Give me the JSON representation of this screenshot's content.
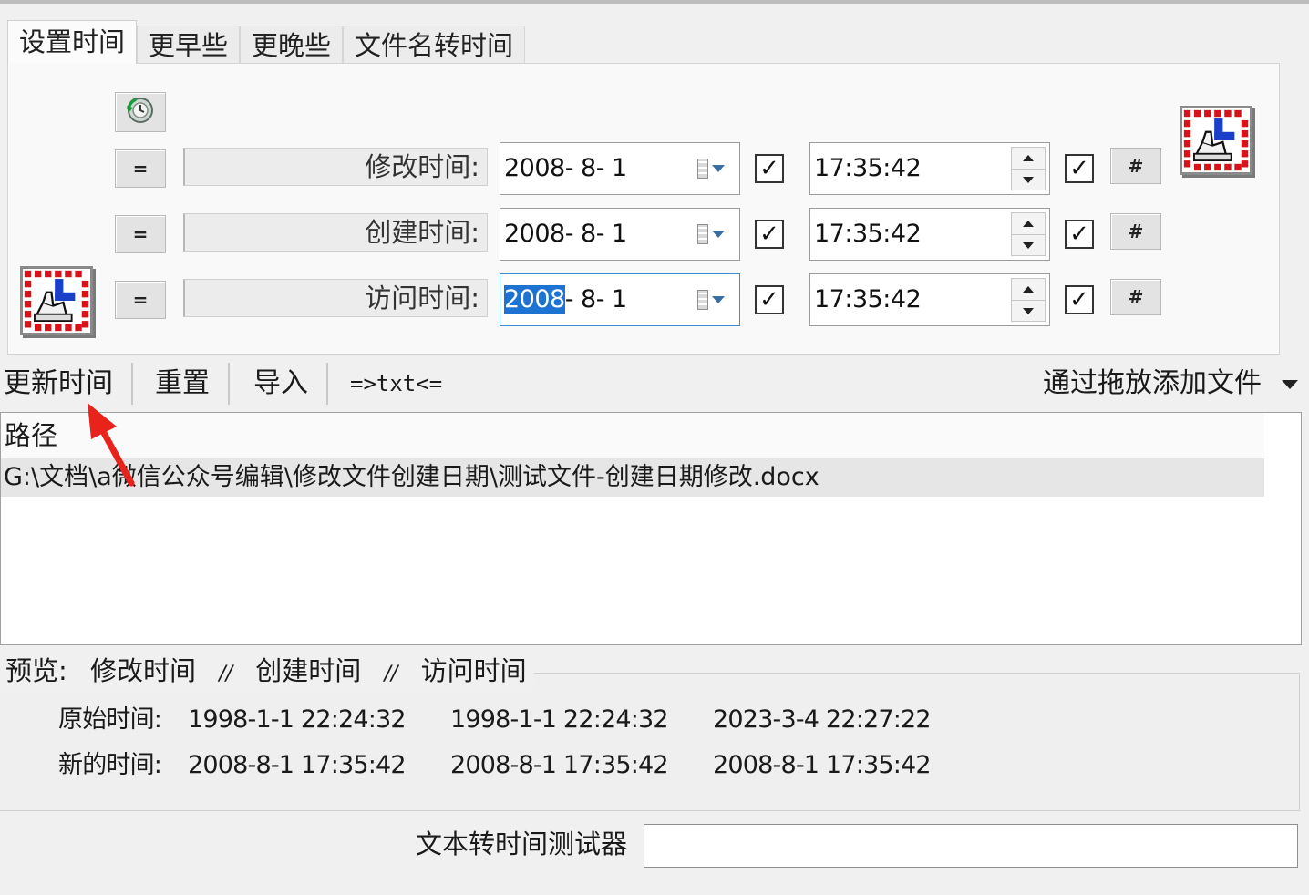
{
  "tabs": [
    "设置时间",
    "更早些",
    "更晚些",
    "文件名转时间"
  ],
  "rows": [
    {
      "label": "修改时间:",
      "date_year": "2008",
      "date_rest": "- 8- 1",
      "time": "17:35:42",
      "date_checked": true,
      "time_checked": true
    },
    {
      "label": "创建时间:",
      "date_year": "2008",
      "date_rest": "- 8- 1",
      "time": "17:35:42",
      "date_checked": true,
      "time_checked": true
    },
    {
      "label": "访问时间:",
      "date_year": "2008",
      "date_rest": "- 8- 1",
      "time": "17:35:42",
      "date_checked": true,
      "time_checked": true
    }
  ],
  "row_buttons": {
    "equals_label": "=",
    "hash_label": "#"
  },
  "icons": {
    "refresh": "refresh-clock-icon",
    "app": "file-time-app-icon",
    "calendar": "calendar-dropdown-icon",
    "spin": "spin-updown-icon"
  },
  "toolbar": {
    "update": "更新时间",
    "reset": "重置",
    "import": "导入",
    "txt": "=>txt<=",
    "drag_add": "通过拖放添加文件"
  },
  "list": {
    "header": "路径",
    "rows": [
      "G:\\文档\\a微信公众号编辑\\修改文件创建日期\\测试文件-创建日期修改.docx"
    ]
  },
  "preview": {
    "legend": [
      "预览:",
      "修改时间",
      "//",
      "创建时间",
      "//",
      "访问时间"
    ],
    "original_label": "原始时间:",
    "original": [
      "1998-1-1 22:24:32",
      "1998-1-1 22:24:32",
      "2023-3-4 22:27:22"
    ],
    "new_label": "新的时间:",
    "new": [
      "2008-8-1 17:35:42",
      "2008-8-1 17:35:42",
      "2008-8-1 17:35:42"
    ]
  },
  "tester": {
    "label": "文本转时间测试器",
    "value": ""
  },
  "colors": {
    "selection": "#1c73d1",
    "annotation_arrow": "#e8231c",
    "icon_red": "#d4141a",
    "icon_blue": "#1a3fc9"
  }
}
